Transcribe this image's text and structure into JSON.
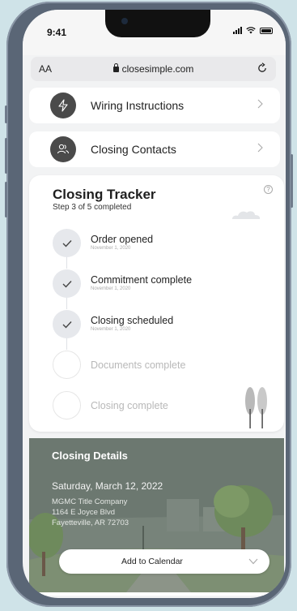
{
  "status_bar": {
    "time": "9:41"
  },
  "browser": {
    "aa_label": "AA",
    "url": "closesimple.com"
  },
  "menu": {
    "wiring_label": "Wiring Instructions",
    "contacts_label": "Closing Contacts"
  },
  "tracker": {
    "title": "Closing Tracker",
    "subtitle": "Step 3 of 5 completed",
    "steps": [
      {
        "label": "Order opened",
        "date": "November 1, 2020",
        "done": true
      },
      {
        "label": "Commitment complete",
        "date": "November 1, 2020",
        "done": true
      },
      {
        "label": "Closing scheduled",
        "date": "November 1, 2020",
        "done": true
      },
      {
        "label": "Documents complete",
        "done": false
      },
      {
        "label": "Closing complete",
        "done": false
      }
    ],
    "help_glyph": "?"
  },
  "details": {
    "title": "Closing Details",
    "date": "Saturday, March 12, 2022",
    "company": "MGMC Title Company",
    "street": "1164 E Joyce Blvd",
    "city": "Fayetteville, AR 72703",
    "calendar_label": "Add to Calendar"
  },
  "colors": {
    "phone_frame": "#5a6676",
    "icon_dark": "#4a4a4a",
    "details_bg": "#6e7a72"
  }
}
